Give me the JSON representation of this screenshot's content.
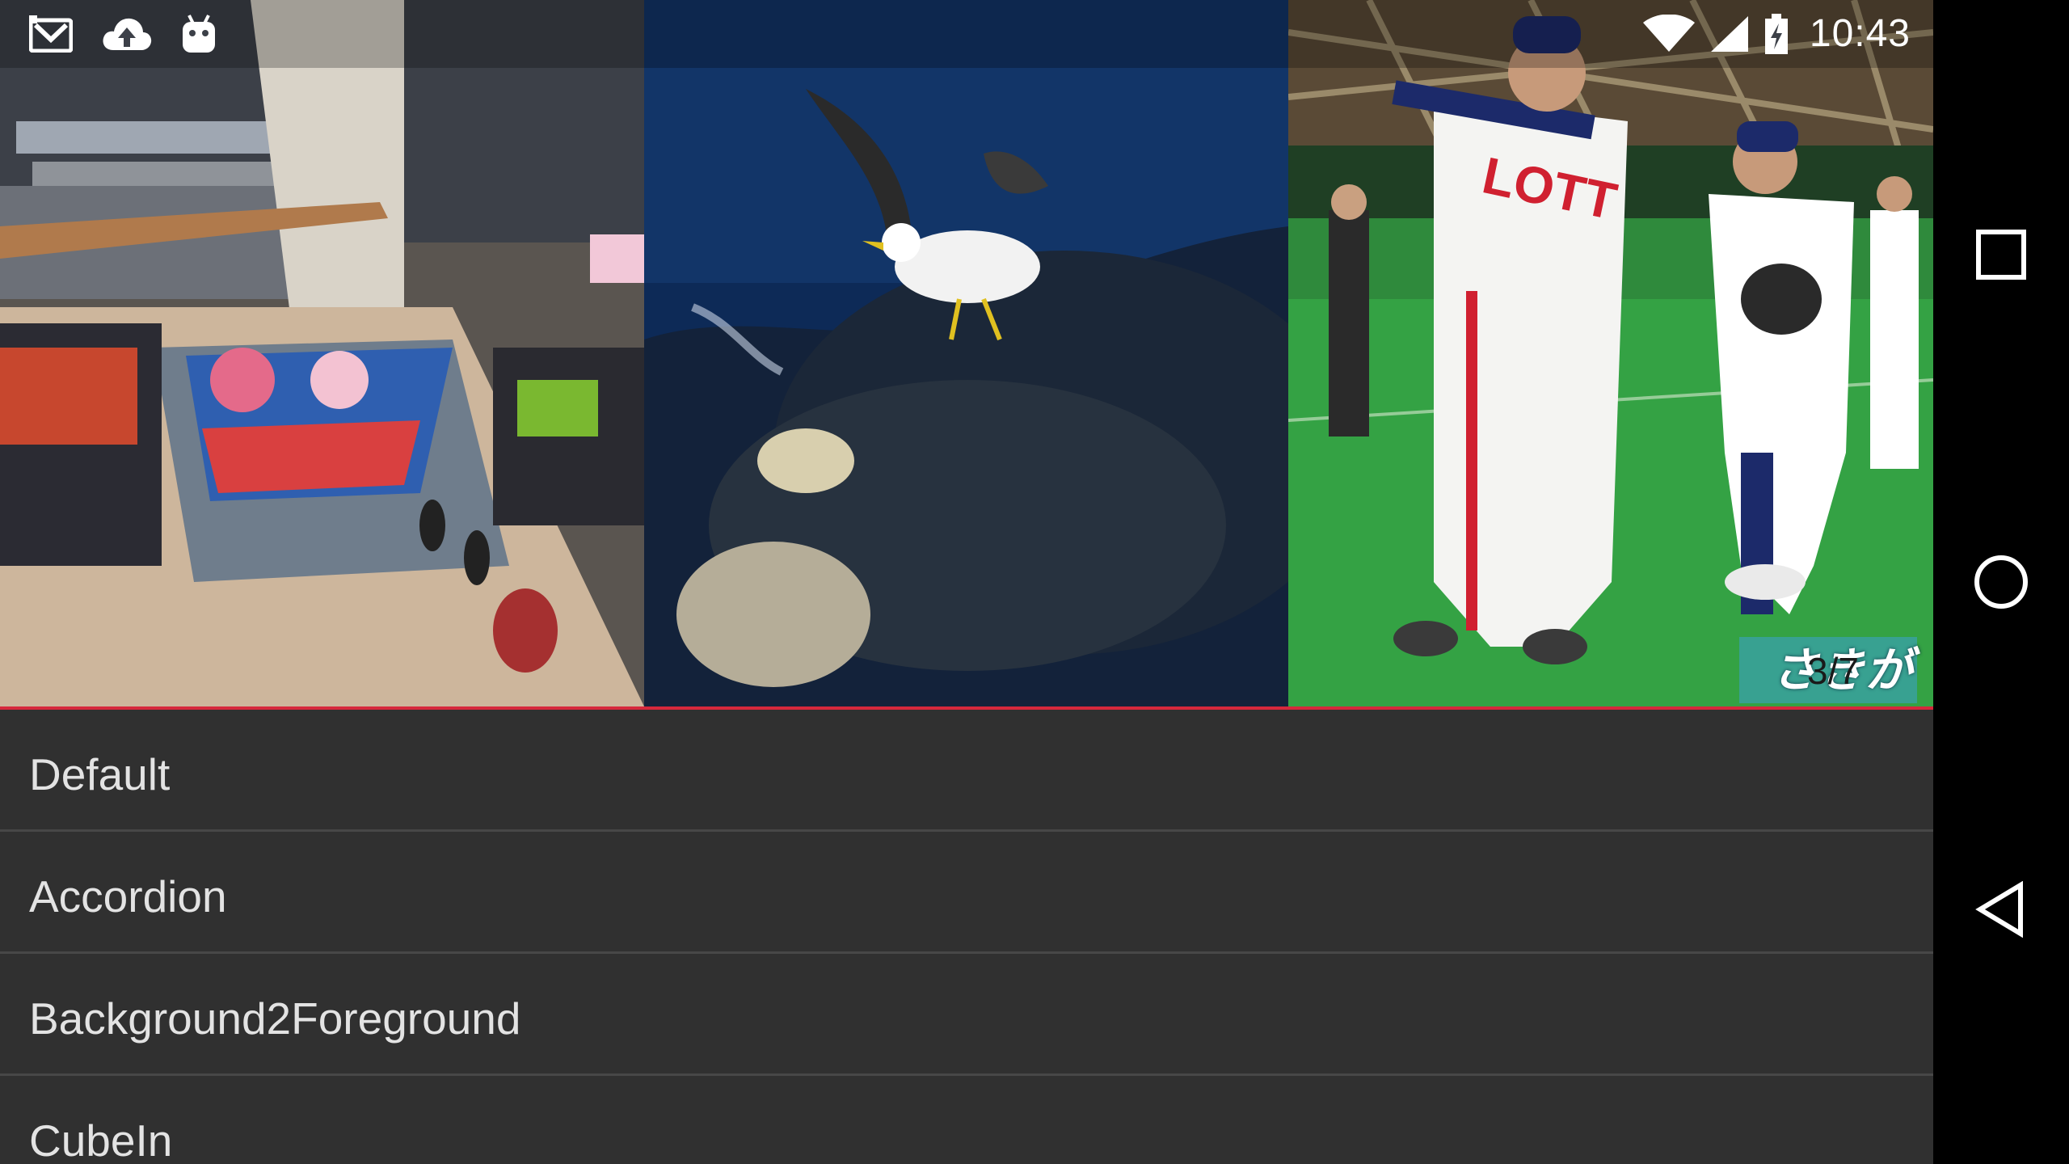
{
  "status_bar": {
    "time": "10:43",
    "left_icons": [
      "gmail-icon",
      "cloud-upload-icon",
      "android-icon"
    ],
    "right_icons": [
      "wifi-icon",
      "cell-signal-icon",
      "battery-charging-icon"
    ]
  },
  "slider": {
    "counter": "3/7",
    "caption": "さきがけ The We",
    "slides": [
      {
        "name": "airport-sleeping-children-photo"
      },
      {
        "name": "seagull-on-whale-photo"
      },
      {
        "name": "baseball-coach-and-boy-photo"
      }
    ],
    "accent_color": "#d6283c"
  },
  "list": {
    "items": [
      {
        "label": "Default"
      },
      {
        "label": "Accordion"
      },
      {
        "label": "Background2Foreground"
      },
      {
        "label": "CubeIn"
      }
    ]
  },
  "nav_bar": {
    "icons": [
      "recents-square-icon",
      "home-circle-icon",
      "back-triangle-icon"
    ]
  },
  "colors": {
    "list_background": "#303030",
    "divider": "#474747",
    "text": "#e3e3e3"
  }
}
